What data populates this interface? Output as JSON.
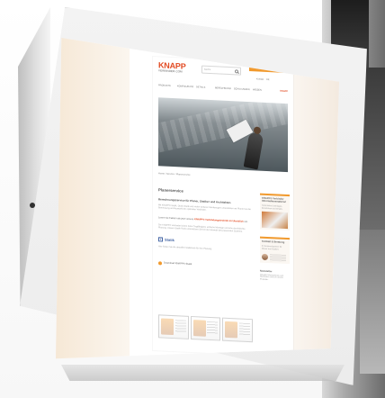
{
  "site": {
    "logo_main": "KNAPP",
    "logo_sub": "VERBINDER.COM",
    "search_placeholder": "Suche",
    "top_highlight": "B2B KUNDENLOGIN",
    "header_links": [
      "Kontakt",
      "DE"
    ],
    "nav": [
      "PRODUKTE",
      "KONFIGURATOR",
      "DETAILS",
      "BERECHNUNGEN",
      "SCHULUNGEN",
      "WISSEN",
      "KNAPP"
    ]
  },
  "breadcrumb": "Home / Service / Planerservice",
  "main": {
    "title": "Planerservice",
    "section_title": "Berechnungsservice für Planer, Statiker und Architekten",
    "intro_text": "Mit KNAPP® Statik, Quick-Statik und vielen weiteren Werkzeugen unterstützen wir Planer bei der Bemessung und Auswahl der optimalen Verbinder.",
    "accent_prefix": "Lesen sie Fakten als jetzt unsere ",
    "accent_highlight": "KNAPP® Verbindungstechnik im Überblick",
    "accent_suffix": "ein.",
    "paragraph_2": "Die KNAPP® Verbinder bieten hohe Tragfähigkeit, einfache Montage und eine durchdachte Planung. Unsere Statik-Tools unterstützen Sie bei der Auswahl des passenden Systems.",
    "statik_label": "Statik",
    "statik_text": "Hier finden Sie die aktuellen Statiktools für Ihre Planung.",
    "download_text": "Download KNAPP® Statik"
  },
  "sidebar": {
    "card_1_title": "KNAPP® Verbinder Informationsmaterial",
    "card_1_text": "Technische Unterlagen, Broschüren und Details.",
    "card_2_title": "Kontakt & Beratung",
    "card_2_text": "Ihr Ansprechpartner für Planer und Statiker.",
    "card_3_title": "Newsletter",
    "card_3_text": "Aktuelle Informationen und Neuheiten rund um unsere Produkte."
  }
}
